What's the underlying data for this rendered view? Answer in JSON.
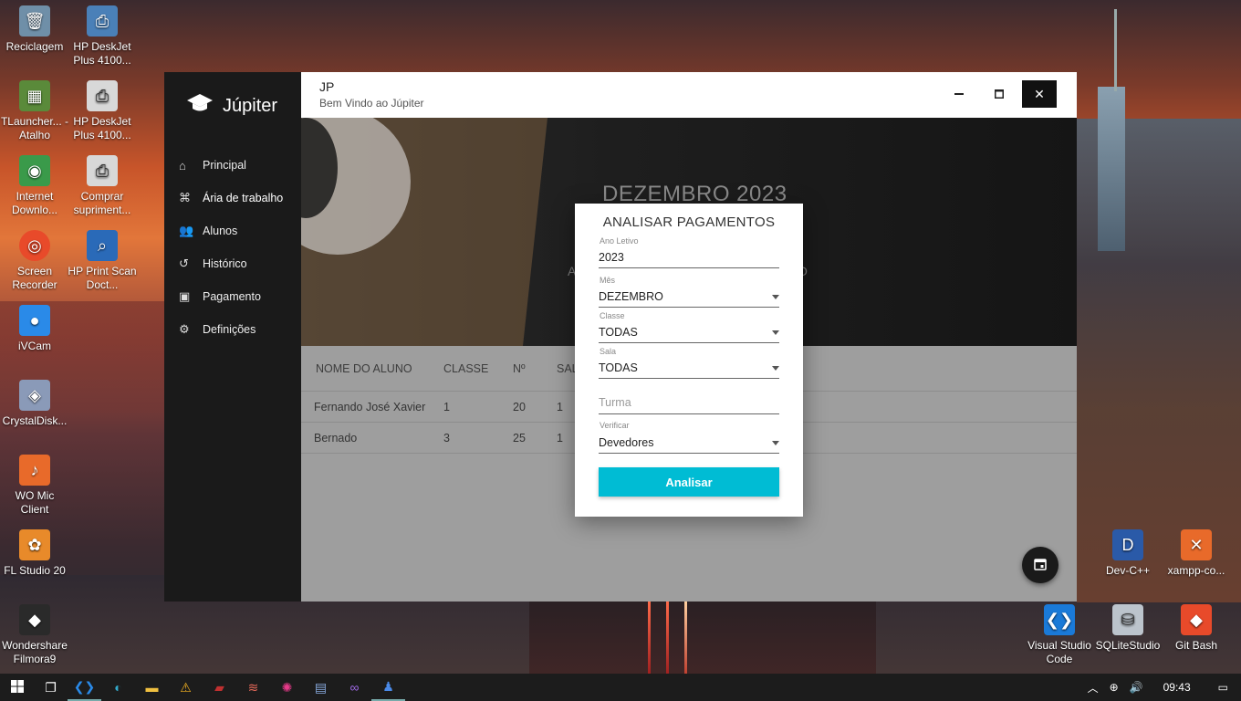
{
  "desktop": {
    "icons": [
      {
        "label": "Reciclagem",
        "icon": "recycle-bin-icon"
      },
      {
        "label": "HP DeskJet Plus 4100...",
        "icon": "printer-icon"
      },
      {
        "label": "TLauncher... - Atalho",
        "icon": "minecraft-icon"
      },
      {
        "label": "HP DeskJet Plus 4100...",
        "icon": "printer-icon"
      },
      {
        "label": "Internet Downlo...",
        "icon": "globe-icon"
      },
      {
        "label": "Comprar supriment...",
        "icon": "printer-icon"
      },
      {
        "label": "Screen Recorder",
        "icon": "record-icon"
      },
      {
        "label": "HP Print Scan Doct...",
        "icon": "scan-icon"
      },
      {
        "label": "iVCam",
        "icon": "camera-icon"
      },
      {
        "label": "CrystalDisk...",
        "icon": "disk-icon"
      },
      {
        "label": "WO Mic Client",
        "icon": "mic-icon"
      },
      {
        "label": "FL Studio 20",
        "icon": "fruit-icon"
      },
      {
        "label": "Wondershare Filmora9",
        "icon": "filmora-icon"
      },
      {
        "label": "Dev-C++",
        "icon": "devcpp-icon"
      },
      {
        "label": "xampp-co...",
        "icon": "xampp-icon"
      },
      {
        "label": "Visual Studio Code",
        "icon": "vscode-icon"
      },
      {
        "label": "SQLiteStudio",
        "icon": "database-icon"
      },
      {
        "label": "Git Bash",
        "icon": "git-icon"
      }
    ]
  },
  "app": {
    "brand": "Júpiter",
    "title": "JP",
    "subtitle": "Bem Vindo ao  Júpiter",
    "nav": [
      {
        "label": "Principal",
        "icon": "home-icon"
      },
      {
        "label": "Ária de trabalho",
        "icon": "command-icon"
      },
      {
        "label": "Alunos",
        "icon": "people-icon"
      },
      {
        "label": "Histórico",
        "icon": "history-icon"
      },
      {
        "label": "Pagamento",
        "icon": "calendar-icon"
      },
      {
        "label": "Definições",
        "icon": "gear-icon"
      }
    ],
    "banner": {
      "month": "DEZEMBRO 2023",
      "sub_left": "A",
      "sub_right": "O"
    },
    "table": {
      "headers": [
        "NOME DO ALUNO",
        "CLASSE",
        "Nº",
        "SAL"
      ],
      "rows": [
        [
          "Fernando José Xavier",
          "1",
          "20",
          "1"
        ],
        [
          "Bernado",
          "3",
          "25",
          "1"
        ]
      ]
    }
  },
  "dialog": {
    "title": "ANALISAR PAGAMENTOS",
    "ano_label": "Ano Letivo",
    "ano_value": "2023",
    "mes_label": "Mês",
    "mes_value": "DEZEMBRO",
    "classe_label": "Classe",
    "classe_value": "TODAS",
    "sala_label": "Sala",
    "sala_value": "TODAS",
    "turma_placeholder": "Turma",
    "verificar_label": "Verificar",
    "verificar_value": "Devedores",
    "button": "Analisar"
  },
  "taskbar": {
    "time": "09:43"
  }
}
